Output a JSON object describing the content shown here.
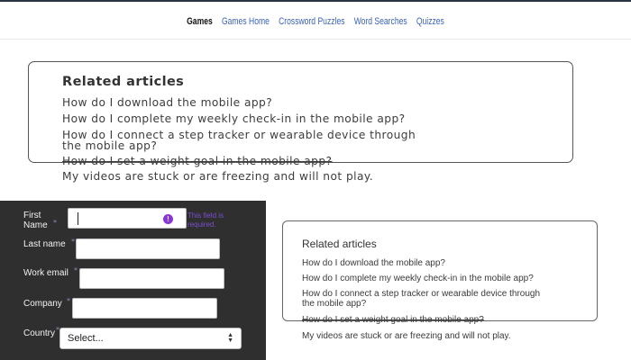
{
  "nav": {
    "items": [
      {
        "label": "Games"
      },
      {
        "label": "Games Home"
      },
      {
        "label": "Crossword Puzzles"
      },
      {
        "label": "Word Searches"
      },
      {
        "label": "Quizzes"
      }
    ]
  },
  "related_big": {
    "title": "Related articles",
    "links": [
      "How do I download the mobile app?",
      "How do I complete my weekly check-in in the mobile app?",
      "How do I connect a step tracker or wearable device through\nthe mobile app?",
      "How do I set a weight goal in the mobile app?",
      "My videos are stuck or are freezing and will not play."
    ]
  },
  "form": {
    "first_name_label": "First\nName",
    "last_name_label": "Last name",
    "work_email_label": "Work email",
    "company_label": "Company",
    "country_label": "Country",
    "required_marker": "*",
    "error_icon": "!",
    "error_text": "This field is required.",
    "country_value": "Select...",
    "select_arrows": "▲\n▼"
  },
  "related_small": {
    "title": "Related articles",
    "links": [
      "How do I download the mobile app?",
      "How do I complete my weekly check-in in the mobile app?",
      "How do I connect a step tracker or wearable device through\nthe mobile app?",
      "How do I set a weight goal in the mobile app?",
      "My videos are stuck or are freezing and will not play."
    ]
  }
}
